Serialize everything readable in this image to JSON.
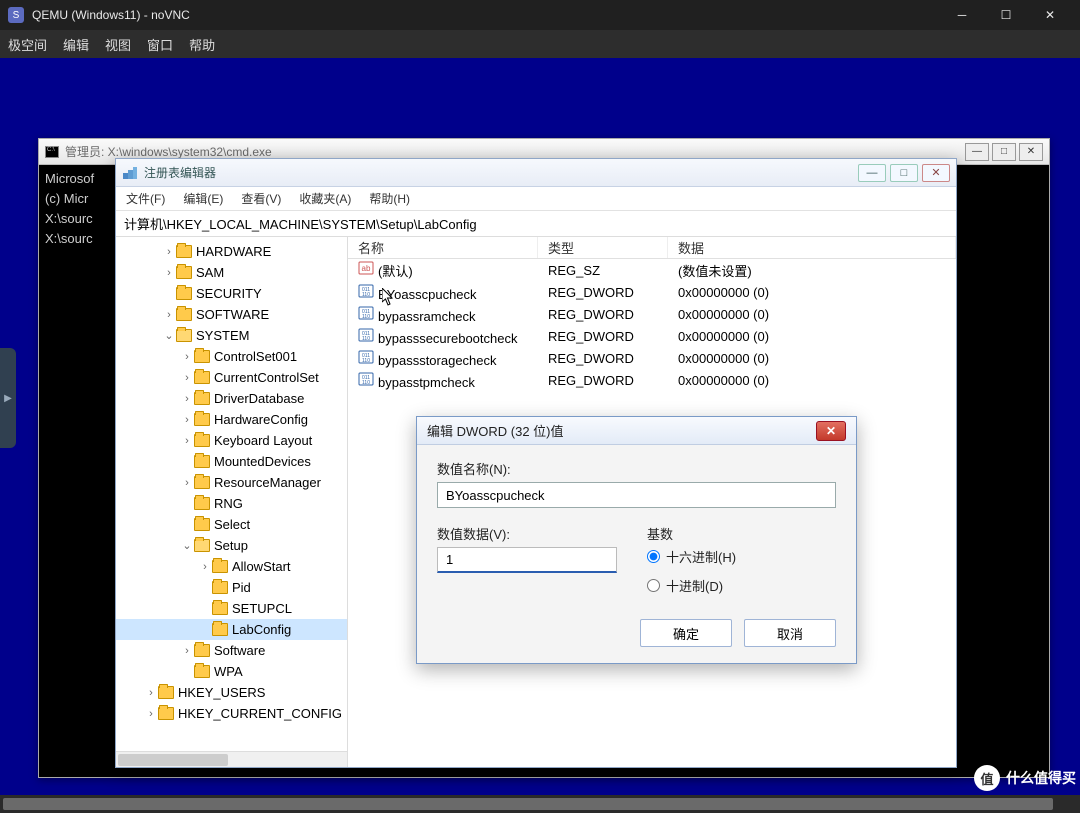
{
  "vnc": {
    "title": "QEMU (Windows11) - noVNC",
    "menu": [
      "极空间",
      "编辑",
      "视图",
      "窗口",
      "帮助"
    ]
  },
  "cmd": {
    "title": "管理员: X:\\windows\\system32\\cmd.exe",
    "lines": [
      "Microsof",
      "(c) Micr",
      "",
      "X:\\sourc",
      "",
      "X:\\sourc"
    ]
  },
  "regedit": {
    "title": "注册表编辑器",
    "menu": [
      "文件(F)",
      "编辑(E)",
      "查看(V)",
      "收藏夹(A)",
      "帮助(H)"
    ],
    "address": "计算机\\HKEY_LOCAL_MACHINE\\SYSTEM\\Setup\\LabConfig",
    "columns": {
      "name": "名称",
      "type": "类型",
      "data": "数据"
    },
    "tree": [
      {
        "indent": 2,
        "exp": ">",
        "label": "HARDWARE"
      },
      {
        "indent": 2,
        "exp": ">",
        "label": "SAM"
      },
      {
        "indent": 2,
        "exp": "",
        "label": "SECURITY"
      },
      {
        "indent": 2,
        "exp": ">",
        "label": "SOFTWARE"
      },
      {
        "indent": 2,
        "exp": "v",
        "label": "SYSTEM",
        "open": true
      },
      {
        "indent": 3,
        "exp": ">",
        "label": "ControlSet001"
      },
      {
        "indent": 3,
        "exp": ">",
        "label": "CurrentControlSet"
      },
      {
        "indent": 3,
        "exp": ">",
        "label": "DriverDatabase"
      },
      {
        "indent": 3,
        "exp": ">",
        "label": "HardwareConfig"
      },
      {
        "indent": 3,
        "exp": ">",
        "label": "Keyboard Layout"
      },
      {
        "indent": 3,
        "exp": "",
        "label": "MountedDevices"
      },
      {
        "indent": 3,
        "exp": ">",
        "label": "ResourceManager"
      },
      {
        "indent": 3,
        "exp": "",
        "label": "RNG"
      },
      {
        "indent": 3,
        "exp": "",
        "label": "Select"
      },
      {
        "indent": 3,
        "exp": "v",
        "label": "Setup",
        "open": true
      },
      {
        "indent": 4,
        "exp": ">",
        "label": "AllowStart"
      },
      {
        "indent": 4,
        "exp": "",
        "label": "Pid"
      },
      {
        "indent": 4,
        "exp": "",
        "label": "SETUPCL"
      },
      {
        "indent": 4,
        "exp": "",
        "label": "LabConfig",
        "selected": true
      },
      {
        "indent": 3,
        "exp": ">",
        "label": "Software"
      },
      {
        "indent": 3,
        "exp": "",
        "label": "WPA"
      },
      {
        "indent": 1,
        "exp": ">",
        "label": "HKEY_USERS"
      },
      {
        "indent": 1,
        "exp": ">",
        "label": "HKEY_CURRENT_CONFIG"
      }
    ],
    "values": [
      {
        "icon": "str",
        "name": "(默认)",
        "type": "REG_SZ",
        "data": "(数值未设置)"
      },
      {
        "icon": "dword",
        "name": "BYoasscpucheck",
        "type": "REG_DWORD",
        "data": "0x00000000 (0)"
      },
      {
        "icon": "dword",
        "name": "bypassramcheck",
        "type": "REG_DWORD",
        "data": "0x00000000 (0)"
      },
      {
        "icon": "dword",
        "name": "bypasssecurebootcheck",
        "type": "REG_DWORD",
        "data": "0x00000000 (0)"
      },
      {
        "icon": "dword",
        "name": "bypassstoragecheck",
        "type": "REG_DWORD",
        "data": "0x00000000 (0)"
      },
      {
        "icon": "dword",
        "name": "bypasstpmcheck",
        "type": "REG_DWORD",
        "data": "0x00000000 (0)"
      }
    ]
  },
  "dialog": {
    "title": "编辑 DWORD (32 位)值",
    "name_label": "数值名称(N):",
    "name_value": "BYoasscpucheck",
    "data_label": "数值数据(V):",
    "data_value": "1",
    "base_label": "基数",
    "radio_hex": "十六进制(H)",
    "radio_dec": "十进制(D)",
    "ok": "确定",
    "cancel": "取消"
  },
  "watermark": {
    "badge": "值",
    "text": "什么值得买"
  }
}
